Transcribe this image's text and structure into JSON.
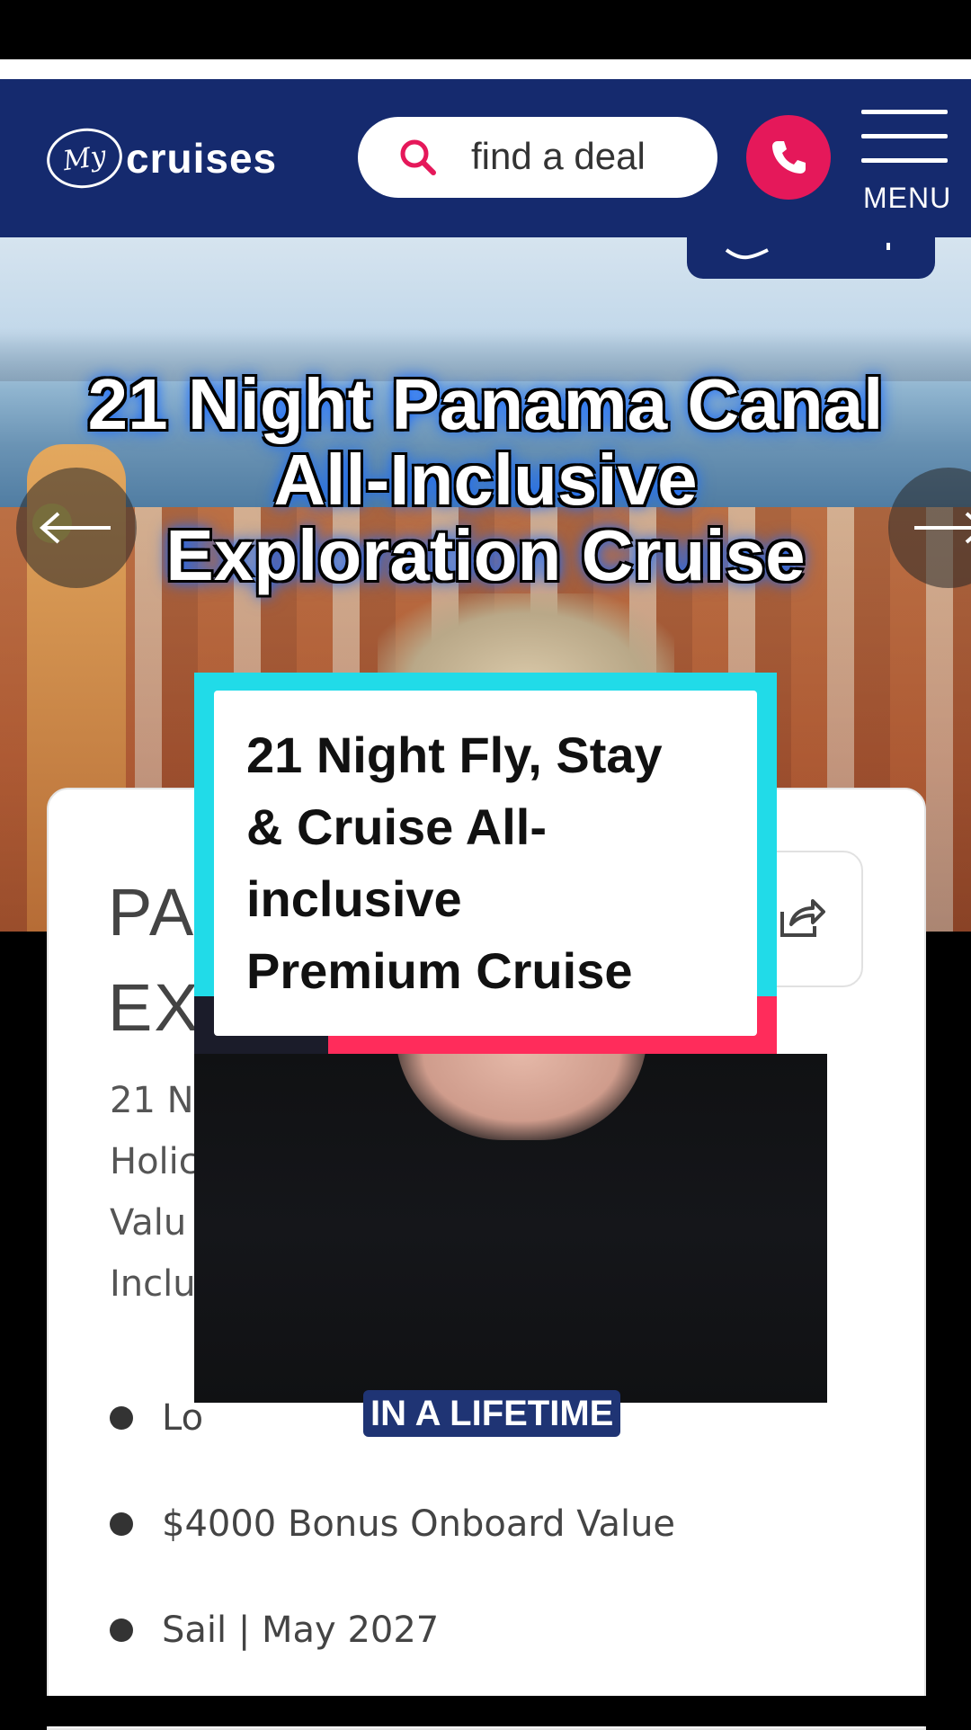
{
  "header": {
    "logo_mark": "My",
    "logo_text": "cruises",
    "search_placeholder": "find a deal",
    "menu_label": "MENU",
    "brand_color": "#152a6e",
    "accent_color": "#e5185a"
  },
  "hero": {
    "headline_line1": "21 Night Panama Canal",
    "headline_line2": "All-Inclusive",
    "headline_line3": "Exploration Cruise"
  },
  "card": {
    "title_line1": "PA",
    "title_line2": "EX",
    "desc_lines": [
      "21 Ni",
      "Holic",
      "Valu",
      "Inclu"
    ],
    "bullets": [
      {
        "text": "Lo"
      },
      {
        "text": "$4000 Bonus Onboard Value"
      },
      {
        "text": "Sail | May 2027"
      }
    ]
  },
  "overlay": {
    "line1": "21 Night Fly, Stay",
    "line2": "& Cruise All-",
    "line3": "inclusive",
    "line4": "Premium Cruise"
  },
  "caption": {
    "text": "IN A LIFETIME"
  },
  "icons": {
    "search": "search-icon",
    "phone": "phone-icon",
    "menu": "hamburger-menu-icon",
    "share": "share-icon",
    "prev": "arrow-left-icon",
    "next": "arrow-right-icon"
  }
}
